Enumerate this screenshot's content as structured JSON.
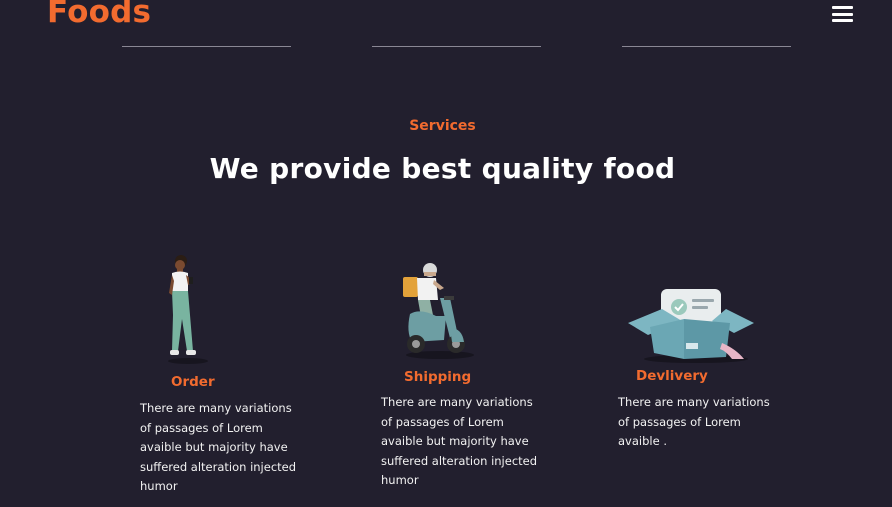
{
  "header": {
    "brand": "Foods",
    "menu_icon": "hamburger-menu-icon"
  },
  "services": {
    "eyebrow": "Services",
    "headline": "We provide best quality food",
    "items": [
      {
        "title": "Order",
        "icon": "person-ordering-illustration",
        "description": "There are many variations of passages of Lorem avaible but majority have suffered alteration injected humor"
      },
      {
        "title": "Shipping",
        "icon": "scooter-delivery-illustration",
        "description": "There are many variations of passages of Lorem avaible but majority have suffered alteration injected humor"
      },
      {
        "title": "Devlivery",
        "icon": "open-box-illustration",
        "description": "There are many variations of passages of Lorem avaible ."
      }
    ]
  },
  "colors": {
    "background": "#221f2e",
    "accent": "#f26b2f",
    "text": "#ffffff"
  }
}
